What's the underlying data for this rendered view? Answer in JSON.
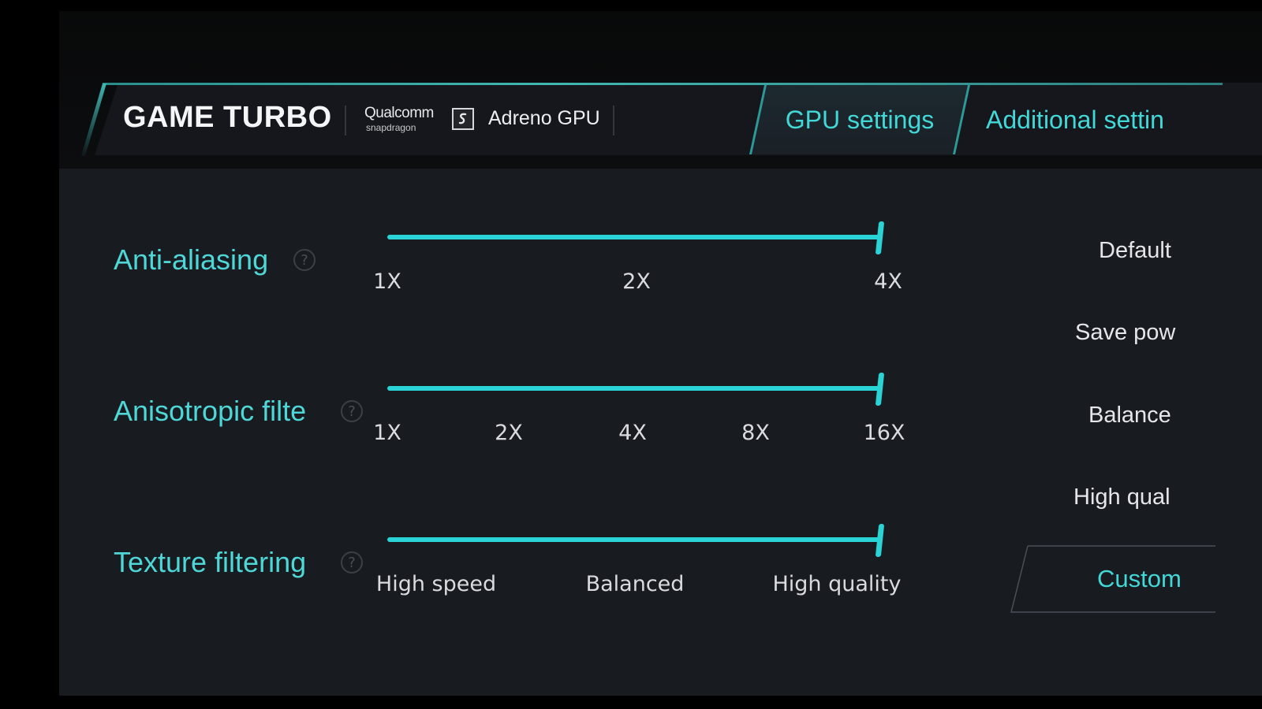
{
  "header": {
    "app_title": "GAME TURBO",
    "chip_brand": "Qualcomm",
    "chip_brand_sub": "snapdragon",
    "chip_logo": "snapdragon-logo",
    "gpu_name": "Adreno GPU"
  },
  "tabs": [
    {
      "label": "GPU settings",
      "active": true
    },
    {
      "label": "Additional settin",
      "active": false
    }
  ],
  "settings": [
    {
      "label": "Anti-aliasing",
      "ticks": [
        "1X",
        "2X",
        "4X"
      ],
      "selected": "4X",
      "value_fraction": 1.0
    },
    {
      "label": "Anisotropic filte",
      "ticks": [
        "1X",
        "2X",
        "4X",
        "8X",
        "16X"
      ],
      "selected": "16X",
      "value_fraction": 1.0
    },
    {
      "label": "Texture filtering",
      "ticks": [
        "High speed",
        "Balanced",
        "High quality"
      ],
      "selected": "High quality",
      "value_fraction": 1.0
    }
  ],
  "presets": [
    {
      "label": "Default"
    },
    {
      "label": "Save pow"
    },
    {
      "label": "Balance"
    },
    {
      "label": "High qual"
    },
    {
      "label": "Custom",
      "selected": true
    }
  ],
  "colors": {
    "accent": "#2ad3d6",
    "label_text": "#4fd6d6",
    "background": "#181b20"
  }
}
